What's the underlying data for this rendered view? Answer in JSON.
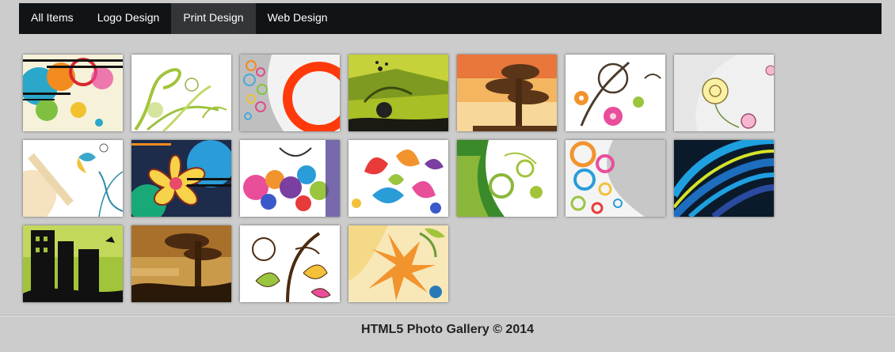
{
  "nav": {
    "items": [
      {
        "label": "All Items"
      },
      {
        "label": "Logo Design"
      },
      {
        "label": "Print Design",
        "active": true
      },
      {
        "label": "Web Design"
      }
    ]
  },
  "footer": {
    "text": "HTML5 Photo Gallery © 2014"
  },
  "gallery": {
    "thumbnails": [
      {
        "art": "colorful-circles-stripes-icon"
      },
      {
        "art": "green-floral-swirl-icon"
      },
      {
        "art": "orange-ring-circles-icon"
      },
      {
        "art": "green-grunge-landscape-icon"
      },
      {
        "art": "grunge-tree-orange-icon"
      },
      {
        "art": "floral-swirl-pink-icon"
      },
      {
        "art": "flower-doodle-icon"
      },
      {
        "art": "butterfly-grunge-icon"
      },
      {
        "art": "tropical-flower-icon"
      },
      {
        "art": "colorful-paisley-swirl-icon"
      },
      {
        "art": "paisley-drops-icon"
      },
      {
        "art": "green-gear-floral-icon"
      },
      {
        "art": "colorful-rings-grey-icon"
      },
      {
        "art": "blue-curved-lines-icon"
      },
      {
        "art": "city-silhouette-green-icon"
      },
      {
        "art": "grunge-tree-brown-icon"
      },
      {
        "art": "leaf-swirl-icon"
      },
      {
        "art": "orange-floral-splash-icon"
      }
    ]
  }
}
